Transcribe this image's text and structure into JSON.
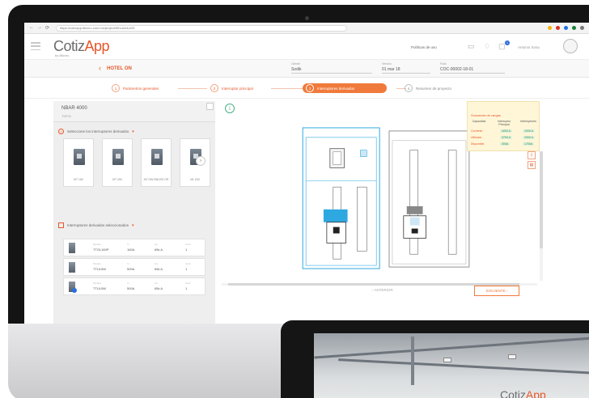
{
  "browser": {
    "url": "https://cotizapp.bticino.com.mx/project/051a2e4d/33",
    "nav_back": "←",
    "nav_fwd": "→",
    "nav_reload": "⟳"
  },
  "header": {
    "logo_main": "Cotiz",
    "logo_accent": "App",
    "logo_sub": "by Bticino",
    "link": "Políticas de uso",
    "user_name": "Antonio Sosa",
    "notifications": "1"
  },
  "project": {
    "name": "HOTEL ON",
    "fields": [
      {
        "label": "Cliente",
        "value": "Sodik"
      },
      {
        "label": "Versión",
        "value": "01 mar 18"
      },
      {
        "label": "Folio",
        "value": "COC-00002-18-01"
      }
    ]
  },
  "steps": [
    {
      "num": "1",
      "label": "Parámetros generales"
    },
    {
      "num": "2",
      "label": "Interruptor principal"
    },
    {
      "num": "3",
      "label": "Interruptores derivados"
    },
    {
      "num": "4",
      "label": "Resumen de proyecto"
    }
  ],
  "left_panel": {
    "model": "NBAR 4000",
    "model_code": "TGF11",
    "select_header": "Seleccione los interruptores derivados",
    "cards": [
      {
        "caption": "MT 160"
      },
      {
        "caption": "MT 250"
      },
      {
        "caption": "MT HW BBUSS OR"
      },
      {
        "caption": "ML 630"
      }
    ],
    "selected_header": "Interruptores derivados seleccionados",
    "columns": [
      "Modelo",
      "In",
      "Icu",
      "Cant."
    ],
    "rows": [
      {
        "model": "TTOL160P",
        "in": "160A",
        "icu": "65k A",
        "qty": "1"
      },
      {
        "model": "TTUL5W",
        "in": "500A",
        "icu": "65k A",
        "qty": "1"
      },
      {
        "model": "TTUL5W",
        "in": "500A",
        "icu": "65k A",
        "qty": "1"
      }
    ]
  },
  "summary": {
    "title": "Sumatoria de cargas",
    "headers": [
      "Capacidad",
      "Interruptor Principal",
      "Interruptores"
    ],
    "rows": [
      {
        "label": "Corriente",
        "a": "4000 A",
        "b": "1000 A"
      },
      {
        "label": "Utilizado",
        "a": "3700 A",
        "b": "2000 A"
      },
      {
        "label": "Disponible",
        "a": "300A",
        "b": "1700A"
      }
    ]
  },
  "nav": {
    "prev": "ANTERIOR",
    "next": "SIGUIENTE"
  },
  "colors": {
    "accent": "#f07a3b",
    "brand": "#e7572a",
    "selected_blue": "#2ea8e0"
  }
}
